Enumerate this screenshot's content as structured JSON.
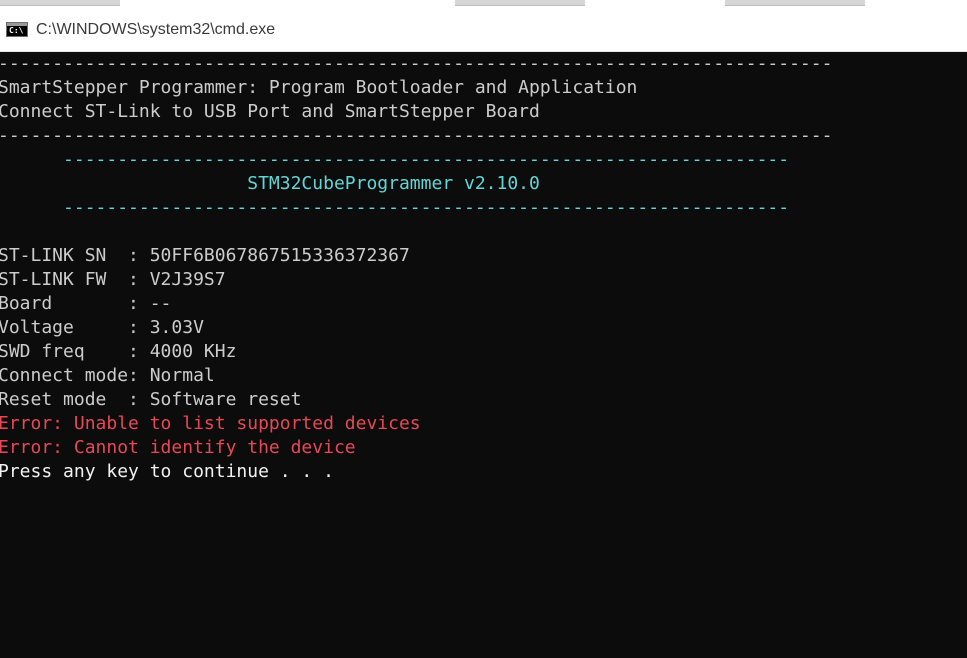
{
  "window": {
    "title": "C:\\WINDOWS\\system32\\cmd.exe",
    "icon": "cmd-icon",
    "icon_text": "C:\\"
  },
  "console": {
    "lines": [
      {
        "text": "-----------------------------------------------------------------------------",
        "color": "#cccccc"
      },
      {
        "text": "SmartStepper Programmer: Program Bootloader and Application",
        "color": "#cccccc"
      },
      {
        "text": "Connect ST-Link to USB Port and SmartStepper Board",
        "color": "#cccccc"
      },
      {
        "text": "-----------------------------------------------------------------------------",
        "color": "#cccccc"
      },
      {
        "text": "      -------------------------------------------------------------------",
        "color": "#61d6d6"
      },
      {
        "text": "                       STM32CubeProgrammer v2.10.0",
        "color": "#61d6d6"
      },
      {
        "text": "      -------------------------------------------------------------------",
        "color": "#61d6d6"
      },
      {
        "text": "",
        "color": "#cccccc"
      },
      {
        "text": "ST-LINK SN  : 50FF6B067867515336372367",
        "color": "#cccccc"
      },
      {
        "text": "ST-LINK FW  : V2J39S7",
        "color": "#cccccc"
      },
      {
        "text": "Board       : --",
        "color": "#cccccc"
      },
      {
        "text": "Voltage     : 3.03V",
        "color": "#cccccc"
      },
      {
        "text": "SWD freq    : 4000 KHz",
        "color": "#cccccc"
      },
      {
        "text": "Connect mode: Normal",
        "color": "#cccccc"
      },
      {
        "text": "Reset mode  : Software reset",
        "color": "#cccccc"
      },
      {
        "text": "Error: Unable to list supported devices",
        "color": "#e74856"
      },
      {
        "text": "Error: Cannot identify the device",
        "color": "#e74856"
      },
      {
        "text": "Press any key to continue . . .",
        "color": "#f2f2f2"
      }
    ]
  },
  "colors": {
    "background": "#0c0c0c",
    "default_text": "#cccccc",
    "cyan_text": "#61d6d6",
    "error_text": "#e74856",
    "bright_text": "#f2f2f2"
  }
}
